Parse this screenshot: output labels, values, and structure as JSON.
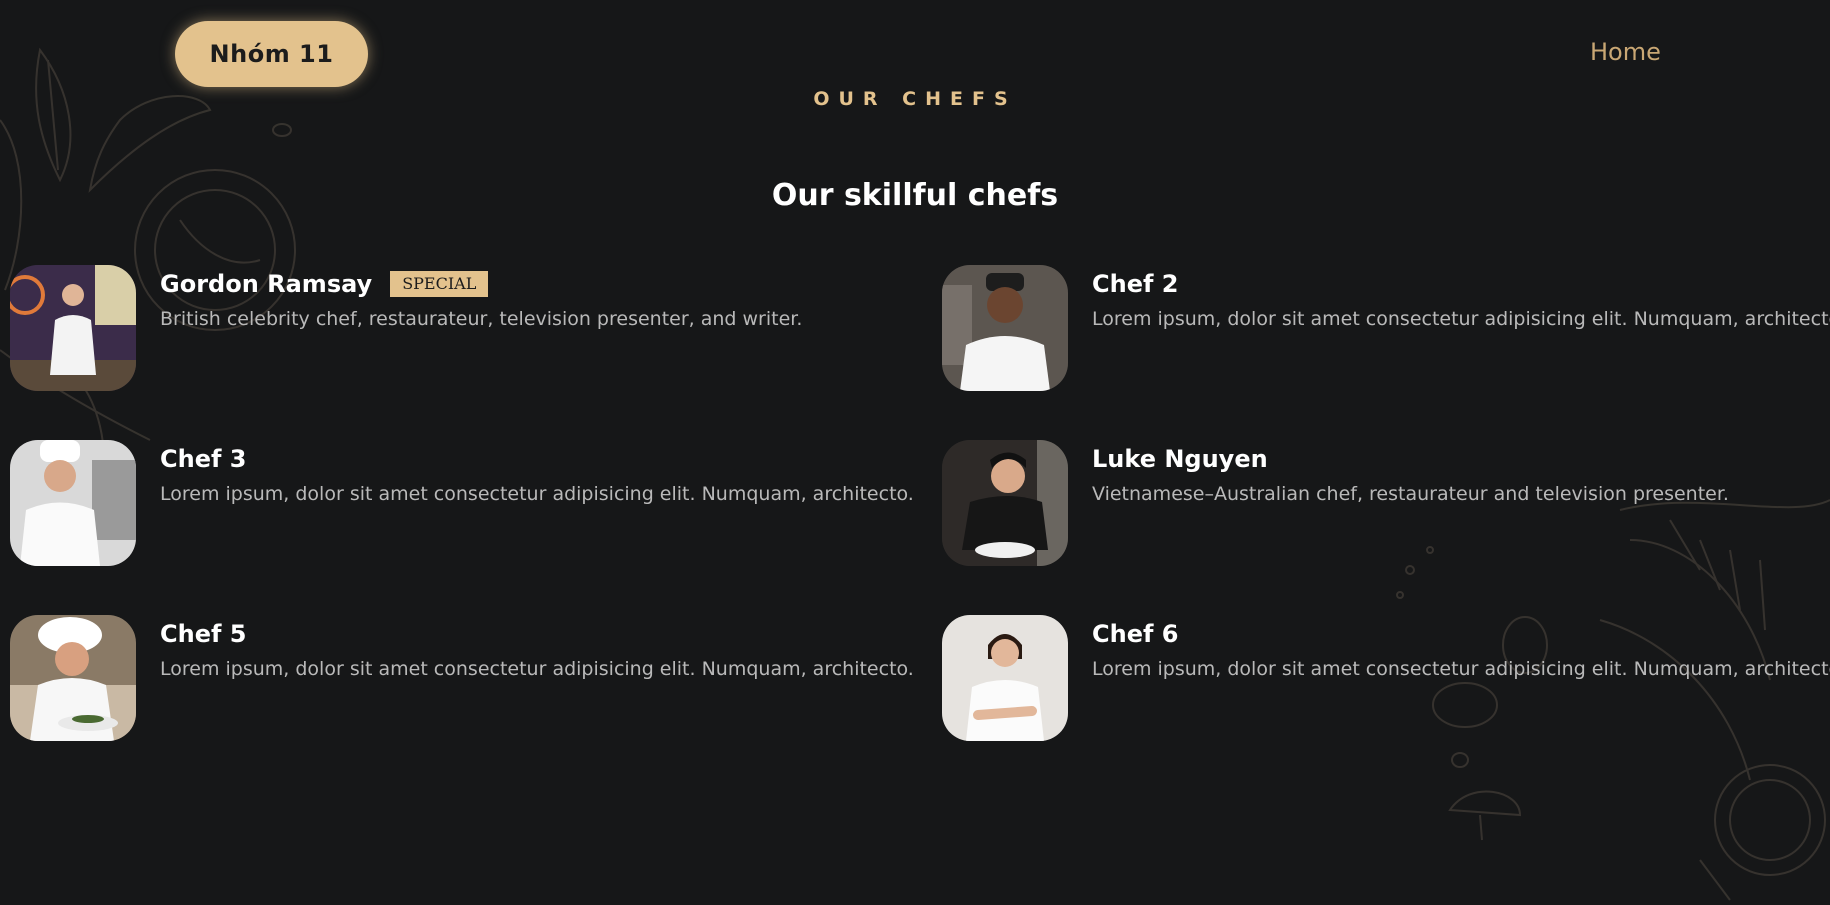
{
  "header": {
    "brand_label": "Nhóm 11",
    "nav_home": "Home"
  },
  "section": {
    "eyebrow": "OUR CHEFS",
    "title": "Our skillful chefs"
  },
  "chefs": [
    {
      "name": "Gordon Ramsay",
      "badge": "SPECIAL",
      "description": "British celebrity chef, restaurateur, television presenter, and writer."
    },
    {
      "name": "Chef 2",
      "description": "Lorem ipsum, dolor sit amet consectetur adipisicing elit. Numquam, architecto."
    },
    {
      "name": "Chef 3",
      "description": "Lorem ipsum, dolor sit amet consectetur adipisicing elit. Numquam, architecto."
    },
    {
      "name": "Luke Nguyen",
      "description": "Vietnamese–Australian chef, restaurateur and television presenter."
    },
    {
      "name": "Chef 5",
      "description": "Lorem ipsum, dolor sit amet consectetur adipisicing elit. Numquam, architecto."
    },
    {
      "name": "Chef 6",
      "description": "Lorem ipsum, dolor sit amet consectetur adipisicing elit. Numquam, architecto."
    }
  ],
  "colors": {
    "background": "#161718",
    "accent": "#e3c28d",
    "nav_link": "#c9a774",
    "description": "#b9b9b9"
  }
}
